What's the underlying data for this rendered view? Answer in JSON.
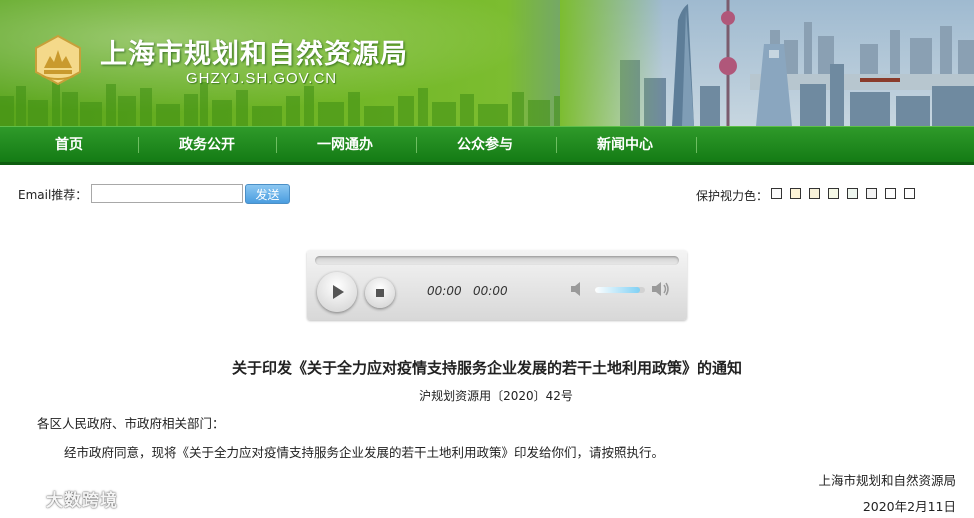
{
  "header": {
    "site_title": "上海市规划和自然资源局",
    "domain": "GHZYJ.SH.GOV.CN",
    "emblem_icon": "city-emblem-icon",
    "colors": {
      "banner_green": "#71b626",
      "nav_green": "#1f8a1f"
    }
  },
  "nav": {
    "items": [
      {
        "label": "首页"
      },
      {
        "label": "政务公开"
      },
      {
        "label": "一网通办"
      },
      {
        "label": "公众参与"
      },
      {
        "label": "新闻中心"
      }
    ]
  },
  "toolbar": {
    "email_label": "Email推荐：",
    "email_value": "",
    "send_label": "发送",
    "eye_care_label": "保护视力色：",
    "eye_care_colors": [
      "#fafafa",
      "#fcf3d7",
      "#f6f0d8",
      "#f5f8e6",
      "#eef6ef",
      "#f3f3f3",
      "#fdfdfd",
      "#ffffff"
    ]
  },
  "player": {
    "current_time": "00:00",
    "total_time": "00:00",
    "progress": 0,
    "volume": 0.9,
    "icons": {
      "play": "play-icon",
      "stop": "stop-icon",
      "mute": "volume-mute-icon",
      "max": "volume-max-icon"
    }
  },
  "article": {
    "title": "关于印发《关于全力应对疫情支持服务企业发展的若干土地利用政策》的通知",
    "doc_number": "沪规划资源用〔2020〕42号",
    "salutation": "各区人民政府、市政府相关部门：",
    "body": "经市政府同意，现将《关于全力应对疫情支持服务企业发展的若干土地利用政策》印发给你们，请按照执行。",
    "signing_org": "上海市规划和自然资源局",
    "date": "2020年2月11日"
  },
  "watermark": {
    "text": "大数跨境"
  }
}
